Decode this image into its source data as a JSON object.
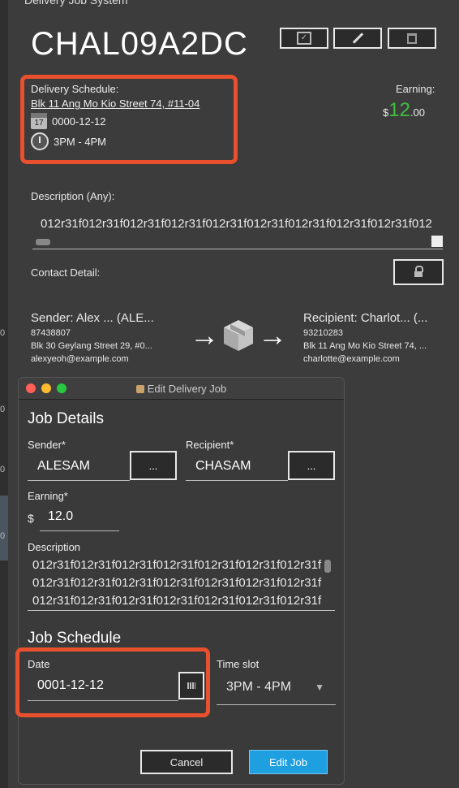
{
  "window": {
    "title": "Delivery Job System"
  },
  "job": {
    "id": "CHAL09A2DC"
  },
  "schedule": {
    "label": "Delivery Schedule:",
    "address": "Blk 11 Ang Mo Kio Street 74, #11-04",
    "date": "0000-12-12",
    "calendar_day": "17",
    "timeslot": "3PM  - 4PM"
  },
  "earning": {
    "label": "Earning:",
    "currency": "$",
    "whole": "12",
    "cents": ".00"
  },
  "description": {
    "label": "Description (Any):",
    "value": "012r31f012r31f012r31f012r31f012r31f012r31f012r31f012r31f012r31f012"
  },
  "contact": {
    "label": "Contact Detail:"
  },
  "sender": {
    "title": "Sender:  Alex ...      (ALE...",
    "phone": "87438807",
    "address": "Blk 30 Geylang Street 29, #0...",
    "email": "alexyeoh@example.com"
  },
  "recipient": {
    "title": "Recipient:  Charlot...      (...",
    "phone": "93210283",
    "address": "Blk 11 Ang Mo Kio Street 74, ...",
    "email": "charlotte@example.com"
  },
  "dialog": {
    "title": "Edit Delivery Job",
    "job_details": "Job Details",
    "sender_label": "Sender*",
    "sender_value": "ALESAM",
    "recipient_label": "Recipient*",
    "recipient_value": "CHASAM",
    "browse_label": "...",
    "earning_label": "Earning*",
    "currency": "$",
    "earning_value": "12.0",
    "description_label": "Description",
    "description_lines": [
      "012r31f012r31f012r31f012r31f012r31f012r31f012r31f",
      "012r31f012r31f012r31f012r31f012r31f012r31f012r31f",
      "012r31f012r31f012r31f012r31f012r31f012r31f012r31f"
    ],
    "job_schedule": "Job Schedule",
    "date_label": "Date",
    "date_value": "0001-12-12",
    "timeslot_label": "Time slot",
    "timeslot_value": "3PM  - 4PM",
    "cancel_label": "Cancel",
    "submit_label": "Edit Job"
  },
  "colors": {
    "highlight": "#e8502e",
    "accent": "#1e9fe0",
    "earning": "#3fbf3f"
  }
}
